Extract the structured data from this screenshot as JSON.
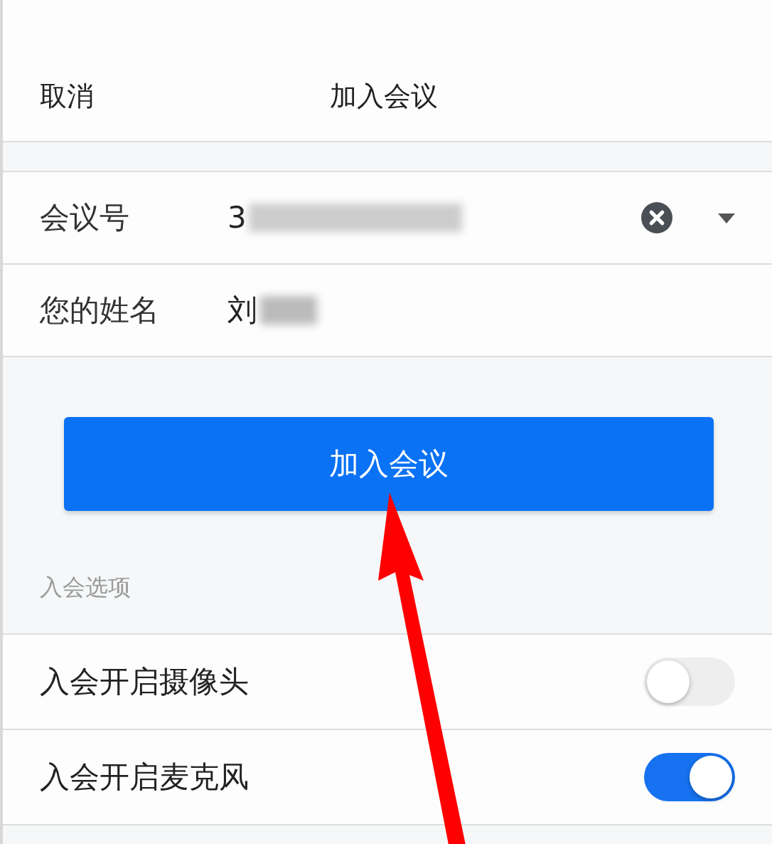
{
  "header": {
    "cancel": "取消",
    "title": "加入会议"
  },
  "fields": [
    {
      "label": "会议号",
      "value": "3",
      "clearable": true,
      "dropdown": true,
      "blurred": true
    },
    {
      "label": "您的姓名",
      "value": "刘",
      "clearable": false,
      "dropdown": false,
      "blurred": true
    }
  ],
  "join_button": "加入会议",
  "options_heading": "入会选项",
  "options": [
    {
      "label": "入会开启摄像头",
      "on": false
    },
    {
      "label": "入会开启麦克风",
      "on": true
    }
  ]
}
